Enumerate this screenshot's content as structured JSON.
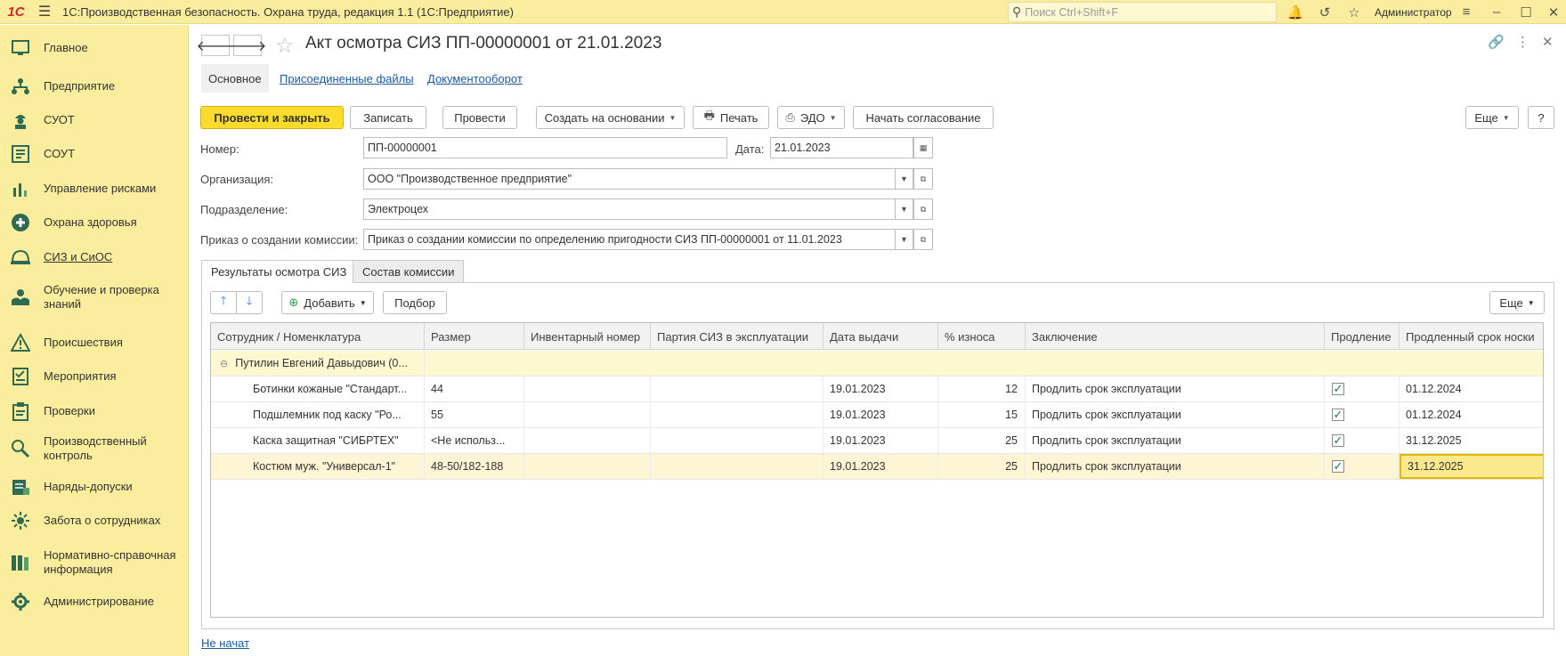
{
  "app": {
    "logo": "1С",
    "title": "1С:Производственная безопасность. Охрана труда, редакция 1.1  (1С:Предприятие)",
    "search_placeholder": "Поиск Ctrl+Shift+F",
    "user": "Администратор"
  },
  "sidebar": {
    "items": [
      {
        "label": "Главное",
        "icon": "home-icon"
      },
      {
        "label": "Предприятие",
        "icon": "org-structure-icon"
      },
      {
        "label": "СУОТ",
        "icon": "worker-icon"
      },
      {
        "label": "СОУТ",
        "icon": "checklist-icon"
      },
      {
        "label": "Управление рисками",
        "icon": "chart-icon"
      },
      {
        "label": "Охрана здоровья",
        "icon": "medical-icon"
      },
      {
        "label": "СИЗ и СиОС",
        "icon": "helmet-icon"
      },
      {
        "label": "Обучение и проверка знаний",
        "icon": "training-icon"
      },
      {
        "label": "Происшествия",
        "icon": "warning-icon"
      },
      {
        "label": "Мероприятия",
        "icon": "tasks-icon"
      },
      {
        "label": "Проверки",
        "icon": "clipboard-icon"
      },
      {
        "label": "Производственный контроль",
        "icon": "control-icon"
      },
      {
        "label": "Наряды-допуски",
        "icon": "permit-icon"
      },
      {
        "label": "Забота о сотрудниках",
        "icon": "care-icon"
      },
      {
        "label": "Нормативно-справочная информация",
        "icon": "books-icon"
      },
      {
        "label": "Администрирование",
        "icon": "admin-icon"
      }
    ]
  },
  "document": {
    "title": "Акт осмотра СИЗ ПП-00000001 от 21.01.2023",
    "subtabs": [
      "Основное",
      "Присоединенные файлы",
      "Документооборот"
    ]
  },
  "toolbar": {
    "post_and_close": "Провести и закрыть",
    "save": "Записать",
    "post": "Провести",
    "create_based_on": "Создать на основании",
    "print": "Печать",
    "edo": "ЭДО",
    "start_approval": "Начать согласование",
    "more": "Еще",
    "help": "?"
  },
  "form": {
    "number_label": "Номер:",
    "number_value": "ПП-00000001",
    "date_label": "Дата:",
    "date_value": "21.01.2023",
    "org_label": "Организация:",
    "org_value": "ООО \"Производственное предприятие\"",
    "dept_label": "Подразделение:",
    "dept_value": "Электроцех",
    "order_label": "Приказ о создании комиссии:",
    "order_value": "Приказ о создании комиссии по определению пригодности СИЗ ПП-00000001 от 11.01.2023"
  },
  "tabs": [
    "Результаты осмотра СИЗ",
    "Состав комиссии"
  ],
  "table_toolbar": {
    "add": "Добавить",
    "select": "Подбор",
    "more": "Еще"
  },
  "table": {
    "columns": [
      "Сотрудник / Номенклатура",
      "Размер",
      "Инвентарный номер",
      "Партия СИЗ в эксплуатации",
      "Дата выдачи",
      "% износа",
      "Заключение",
      "Продление",
      "Продленный срок носки"
    ],
    "group": "Путилин Евгений Давыдович (0...",
    "rows": [
      {
        "item": "Ботинки кожаные \"Стандарт...",
        "size": "44",
        "inv": "",
        "batch": "",
        "date": "19.01.2023",
        "wear": "12",
        "conclusion": "Продлить срок эксплуатации",
        "extend": "✓",
        "extended_until": "01.12.2024"
      },
      {
        "item": "Подшлемник под каску \"Ро...",
        "size": "55",
        "inv": "",
        "batch": "",
        "date": "19.01.2023",
        "wear": "15",
        "conclusion": "Продлить срок эксплуатации",
        "extend": "✓",
        "extended_until": "01.12.2024"
      },
      {
        "item": "Каска защитная \"СИБРТЕХ\"",
        "size": "<Не использ...",
        "inv": "",
        "batch": "",
        "date": "19.01.2023",
        "wear": "25",
        "conclusion": "Продлить срок эксплуатации",
        "extend": "✓",
        "extended_until": "31.12.2025"
      },
      {
        "item": "Костюм муж. \"Универсал-1\"",
        "size": "48-50/182-188",
        "inv": "",
        "batch": "",
        "date": "19.01.2023",
        "wear": "25",
        "conclusion": "Продлить срок эксплуатации",
        "extend": "✓",
        "extended_until": "31.12.2025"
      }
    ]
  },
  "status": {
    "approval_status": "Не начат"
  },
  "colors": {
    "sidebar_bg": "#fbed9e",
    "primary_button": "#fbdb2c",
    "link": "#1d5aa0",
    "focus": "#e1b700"
  }
}
